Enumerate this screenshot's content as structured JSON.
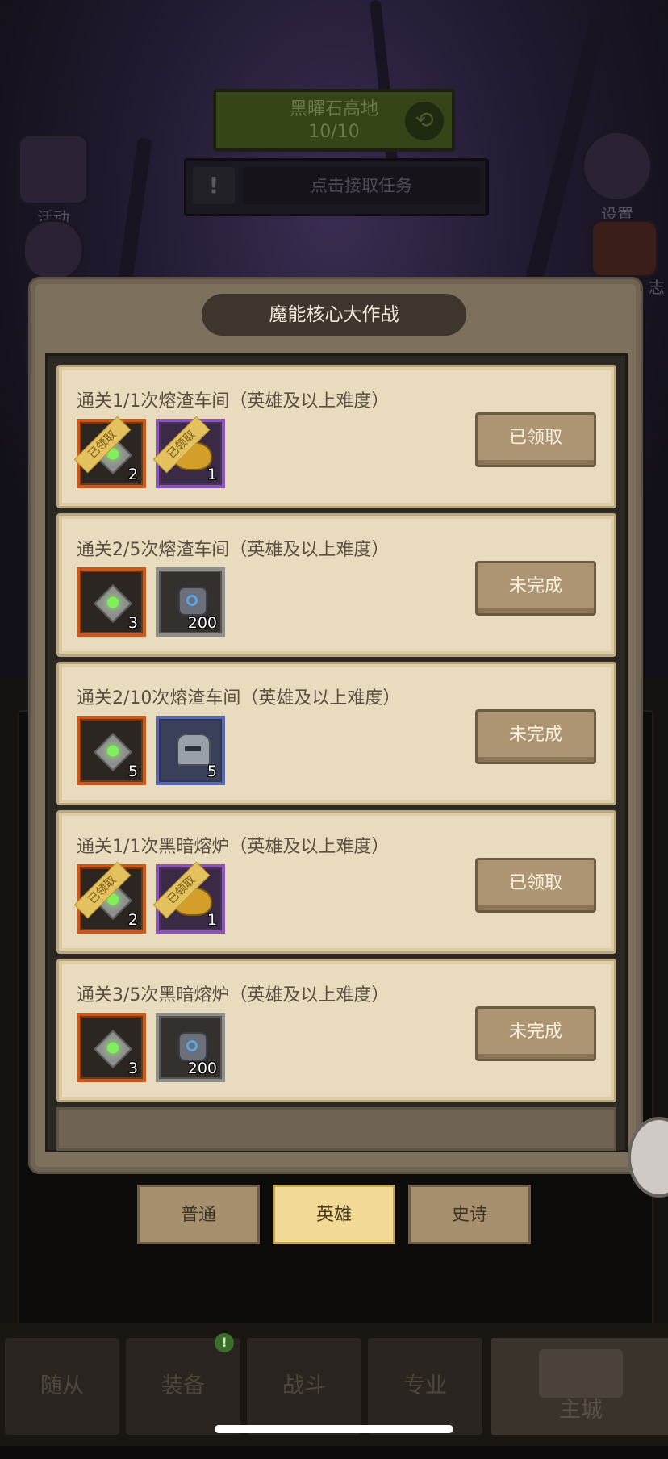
{
  "scene": {
    "zone_title": "黑曜石高地",
    "zone_progress": "10/10",
    "quest_prompt": "点击接取任务",
    "left_icon_label": "活动",
    "right_icon_label": "设置",
    "right_icon2_label": "志"
  },
  "panel": {
    "title": "魔能核心大作战",
    "quests": [
      {
        "text": "通关1/1次熔渣车间（英雄及以上难度）",
        "status": "已领取",
        "rewards": [
          {
            "kind": "crystal-icon",
            "rarity": "orange",
            "count": "2",
            "claimed_label": "已领取"
          },
          {
            "kind": "gold-pile-icon",
            "rarity": "purple",
            "count": "1",
            "claimed_label": "已领取"
          }
        ]
      },
      {
        "text": "通关2/5次熔渣车间（英雄及以上难度）",
        "status": "未完成",
        "rewards": [
          {
            "kind": "crystal-icon",
            "rarity": "orange",
            "count": "3"
          },
          {
            "kind": "gear-icon",
            "rarity": "gray",
            "count": "200"
          }
        ]
      },
      {
        "text": "通关2/10次熔渣车间（英雄及以上难度）",
        "status": "未完成",
        "rewards": [
          {
            "kind": "crystal-icon",
            "rarity": "orange",
            "count": "5"
          },
          {
            "kind": "helmet-icon",
            "rarity": "blue",
            "count": "5"
          }
        ]
      },
      {
        "text": "通关1/1次黑暗熔炉（英雄及以上难度）",
        "status": "已领取",
        "rewards": [
          {
            "kind": "crystal-icon",
            "rarity": "orange",
            "count": "2",
            "claimed_label": "已领取"
          },
          {
            "kind": "gold-pile-icon",
            "rarity": "purple",
            "count": "1",
            "claimed_label": "已领取"
          }
        ]
      },
      {
        "text": "通关3/5次黑暗熔炉（英雄及以上难度）",
        "status": "未完成",
        "rewards": [
          {
            "kind": "crystal-icon",
            "rarity": "orange",
            "count": "3"
          },
          {
            "kind": "gear-icon",
            "rarity": "gray",
            "count": "200"
          }
        ]
      }
    ]
  },
  "tabs": [
    {
      "label": "普通",
      "active": false
    },
    {
      "label": "英雄",
      "active": true
    },
    {
      "label": "史诗",
      "active": false
    }
  ],
  "bottom_nav": [
    {
      "label": "随从"
    },
    {
      "label": "装备",
      "badge": "!"
    },
    {
      "label": "战斗"
    },
    {
      "label": "专业"
    },
    {
      "label": "主城"
    }
  ],
  "colors": {
    "panel_bg": "#7d715e",
    "card_bg": "#e9dcbe",
    "active_tab": "#f2d996",
    "rarity_orange": "#c65a1c",
    "rarity_purple": "#8a54b3",
    "rarity_gray": "#8d8d8d",
    "rarity_blue": "#5a67a8"
  }
}
